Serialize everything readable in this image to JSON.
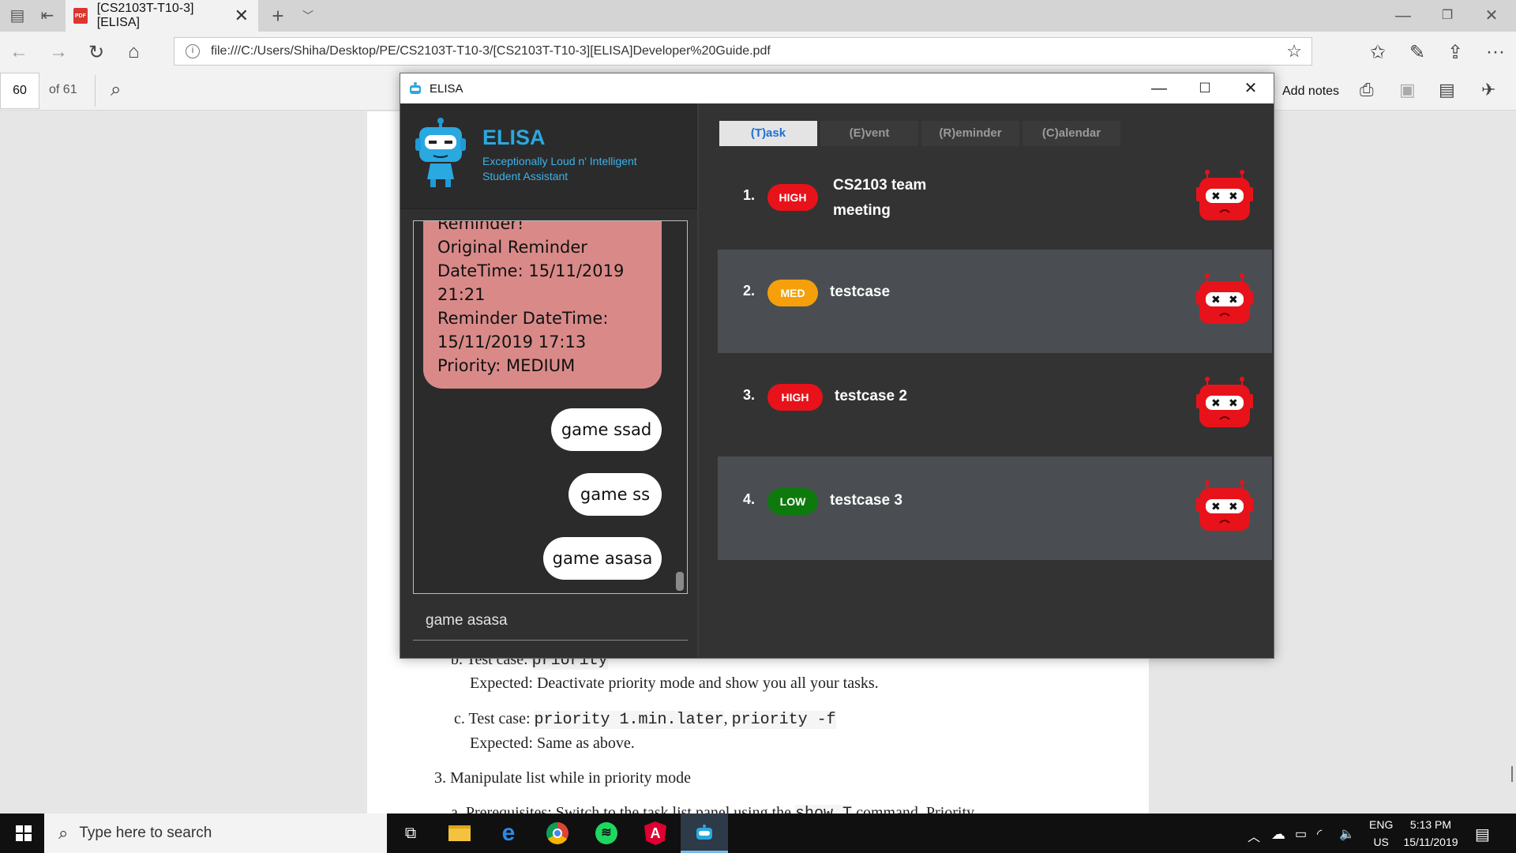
{
  "browser": {
    "tab_title": "[CS2103T-T10-3][ELISA]",
    "tab_icon_text": "PDF",
    "address": "file:///C:/Users/Shiha/Desktop/PE/CS2103T-T10-3/[CS2103T-T10-3][ELISA]Developer%20Guide.pdf",
    "add_notes": "Add notes"
  },
  "pdf": {
    "page_number": "60",
    "page_total": "of 61",
    "lines": {
      "b_label": "b. Test case:",
      "b_code": "priority",
      "b_expected": "Expected: Deactivate priority mode and show you all your tasks.",
      "c_label": "c. Test case:",
      "c_code1": "priority 1.min.later",
      "c_sep": ",",
      "c_code2": "priority -f",
      "c_expected": "Expected: Same as above.",
      "item3": "3. Manipulate list while in priority mode",
      "a_partial": "a. Prerequisites: Switch to the task list panel using the",
      "a_code": "show T",
      "a_rest": "command. Priority"
    }
  },
  "elisa": {
    "window_title": "ELISA",
    "app_name": "ELISA",
    "tagline_line1": "Exceptionally Loud n' Intelligent",
    "tagline_line2": "Student Assistant",
    "chat": {
      "reminder_lines": [
        "Reminder!",
        "Original Reminder",
        "DateTime: 15/11/2019",
        "21:21",
        "Reminder DateTime:",
        "15/11/2019 17:13",
        "Priority: MEDIUM"
      ],
      "user_messages": [
        "game ssad",
        "game ss",
        "game asasa"
      ]
    },
    "command_input": "game asasa",
    "tabs": [
      "(T)ask",
      "(E)vent",
      "(R)eminder",
      "(C)alendar"
    ],
    "tasks": [
      {
        "num": "1.",
        "priority": "HIGH",
        "desc_line1": "CS2103 team",
        "desc_line2": "meeting"
      },
      {
        "num": "2.",
        "priority": "MED",
        "desc_line1": "testcase",
        "desc_line2": ""
      },
      {
        "num": "3.",
        "priority": "HIGH",
        "desc_line1": "testcase 2",
        "desc_line2": ""
      },
      {
        "num": "4.",
        "priority": "LOW",
        "desc_line1": "testcase 3",
        "desc_line2": ""
      }
    ],
    "colors": {
      "high": "#e8121a",
      "med": "#f5a00a",
      "low": "#0e7a0e",
      "accent": "#2aa8e0",
      "reminder_bubble": "#d98a88"
    }
  },
  "taskbar": {
    "search_placeholder": "Type here to search",
    "lang1": "ENG",
    "lang2": "US",
    "time": "5:13 PM",
    "date": "15/11/2019"
  }
}
